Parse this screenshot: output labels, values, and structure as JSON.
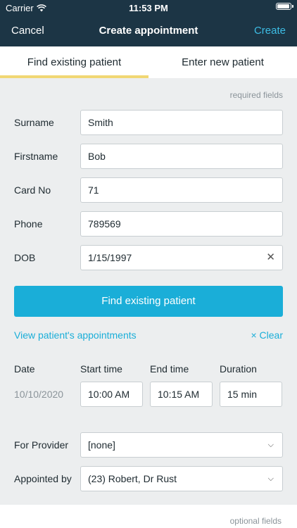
{
  "status": {
    "carrier": "Carrier",
    "time": "11:53 PM",
    "battery_level": 0.95
  },
  "nav": {
    "cancel": "Cancel",
    "title": "Create appointment",
    "create": "Create"
  },
  "tabs": [
    {
      "label": "Find existing patient",
      "active": true
    },
    {
      "label": "Enter new patient",
      "active": false
    }
  ],
  "required_note": "required fields",
  "fields": {
    "surname": {
      "label": "Surname",
      "value": "Smith"
    },
    "firstname": {
      "label": "Firstname",
      "value": "Bob"
    },
    "card_no": {
      "label": "Card No",
      "value": "71"
    },
    "phone": {
      "label": "Phone",
      "value": "789569"
    },
    "dob": {
      "label": "DOB",
      "value": "1/15/1997"
    }
  },
  "find_button": "Find existing patient",
  "view_link": "View patient's appointments",
  "clear_link": "× Clear",
  "schedule": {
    "headers": {
      "date": "Date",
      "start": "Start time",
      "end": "End time",
      "duration": "Duration"
    },
    "date": "10/10/2020",
    "start": "10:00 AM",
    "end": "10:15 AM",
    "duration": "15 min"
  },
  "provider": {
    "label": "For Provider",
    "value": "[none]"
  },
  "appointed_by": {
    "label": "Appointed by",
    "value": "(23) Robert, Dr Rust"
  },
  "optional_note": "optional fields",
  "colors": {
    "nav_bg": "#1c3545",
    "accent": "#1aaed8",
    "tab_indicator": "#f1d774"
  }
}
